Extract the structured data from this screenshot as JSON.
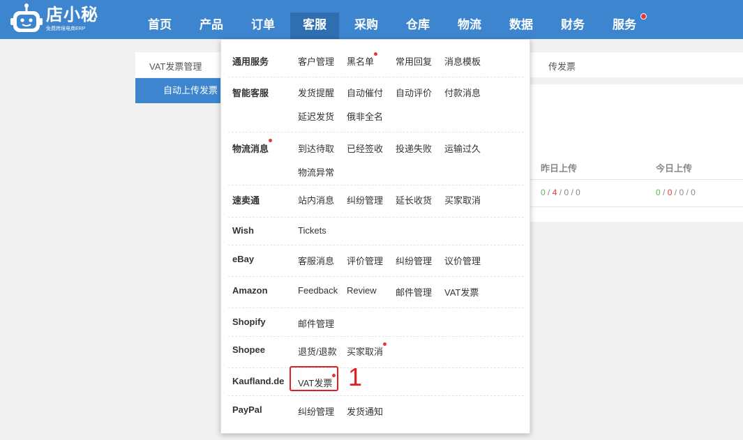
{
  "brand": {
    "name": "店小秘",
    "tagline": "免费跨境电商ERP"
  },
  "nav": {
    "items": [
      "首页",
      "产品",
      "订单",
      "客服",
      "采购",
      "仓库",
      "物流",
      "数据",
      "财务",
      "服务"
    ],
    "active_index": 3
  },
  "page": {
    "tab_vat": "VAT发票管理",
    "tab_right_partial": "传发票",
    "sidebar_active": "自动上传发票",
    "col_yesterday": "昨日上传",
    "col_today": "今日上传",
    "yesterday": [
      "0",
      "4",
      "0",
      "0"
    ],
    "today": [
      "0",
      "0",
      "0",
      "0"
    ]
  },
  "dropdown": {
    "sections": [
      {
        "category": "通用服务",
        "items": [
          "客户管理",
          "黑名单",
          "常用回复",
          "消息模板"
        ]
      },
      {
        "category": "智能客服",
        "items": [
          "发货提醒",
          "自动催付",
          "自动评价",
          "付款消息",
          "延迟发货",
          "俄非全名"
        ]
      },
      {
        "category": "物流消息",
        "items": [
          "到达待取",
          "已经签收",
          "投递失败",
          "运输过久",
          "物流异常"
        ]
      },
      {
        "category": "速卖通",
        "items": [
          "站内消息",
          "纠纷管理",
          "延长收货",
          "买家取消"
        ]
      },
      {
        "category": "Wish",
        "items": [
          "Tickets"
        ]
      },
      {
        "category": "eBay",
        "items": [
          "客服消息",
          "评价管理",
          "纠纷管理",
          "议价管理"
        ]
      },
      {
        "category": "Amazon",
        "items": [
          "Feedback",
          "Review",
          "邮件管理",
          "VAT发票"
        ]
      },
      {
        "category": "Shopify",
        "items": [
          "邮件管理"
        ]
      },
      {
        "category": "Shopee",
        "items": [
          "退货/退款",
          "买家取消"
        ]
      },
      {
        "category": "Kaufland.de",
        "items": [
          "VAT发票"
        ]
      },
      {
        "category": "PayPal",
        "items": [
          "纠纷管理",
          "发货通知"
        ]
      }
    ]
  },
  "annotation": {
    "number": "1"
  },
  "colors": {
    "nav_bg": "#3d86cf",
    "nav_active": "#2f6fb1",
    "accent_red": "#e02020"
  }
}
